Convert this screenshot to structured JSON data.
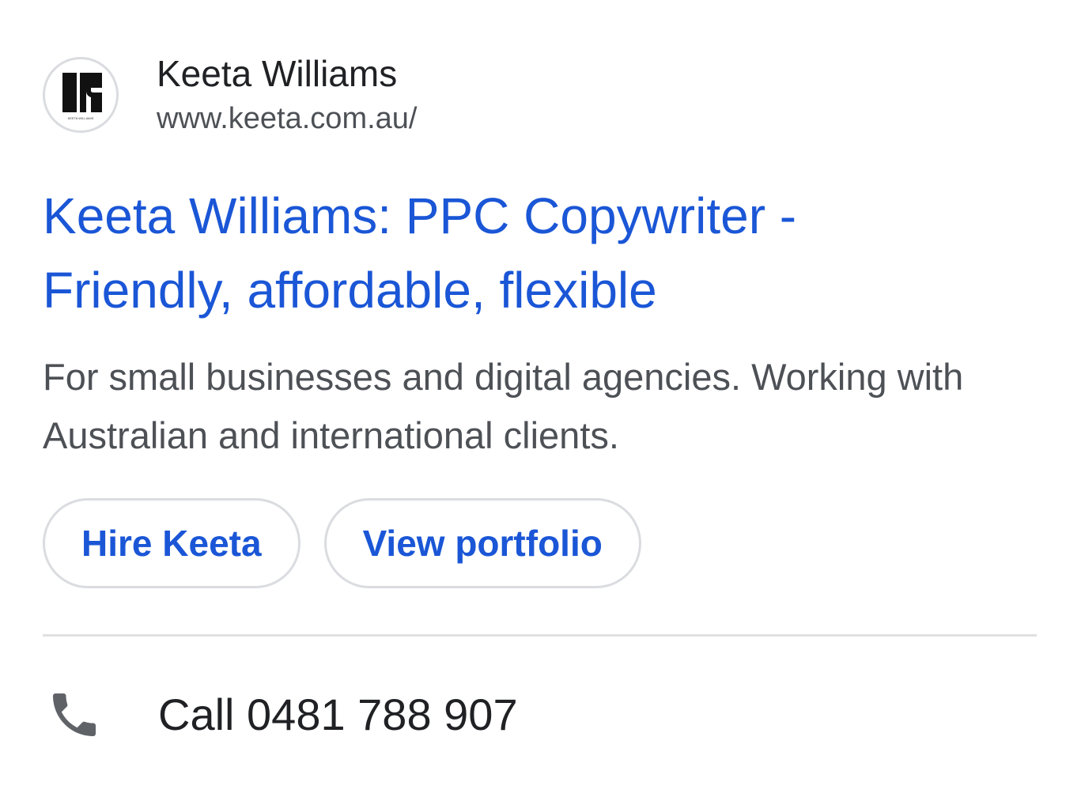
{
  "site": {
    "name": "Keeta Williams",
    "url": "www.keeta.com.au/",
    "logo_text": "KEETA WILLIAMS"
  },
  "ad": {
    "headline_line1": "Keeta Williams: PPC Copywriter -",
    "headline_line2": "Friendly, affordable, flexible",
    "description": "For small businesses and digital agencies. Working with Australian and international clients."
  },
  "actions": {
    "hire_label": "Hire Keeta",
    "portfolio_label": "View portfolio"
  },
  "call": {
    "label": "Call 0481 788 907",
    "icon": "phone-icon"
  },
  "colors": {
    "link": "#1a56d6",
    "text": "#202124",
    "secondary": "#4d5156",
    "border": "#dadce0"
  }
}
